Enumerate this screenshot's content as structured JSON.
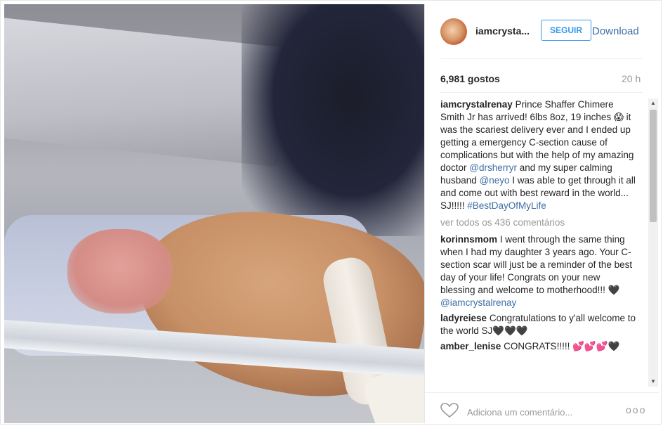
{
  "post": {
    "username": "iamcrysta...",
    "follow_label": "SEGUIR",
    "download_label": "Download",
    "likes": "6,981 gostos",
    "time": "20 h",
    "caption": {
      "user": "iamcrystalrenay",
      "text1": " Prince Shaffer Chimere Smith Jr has arrived! 6lbs 8oz, 19 inches 😱 it was the scariest delivery ever and I ended up getting a emergency C-section cause of complications but with the help of my amazing doctor ",
      "mention1": "@drsherryr",
      "text2": " and my super calming husband ",
      "mention2": "@neyo",
      "text3": " I was able to get through it all and come out with best reward in the world... SJ!!!!! ",
      "hashtag": "#BestDayOfMyLife"
    },
    "view_all": "ver todos os 436 comentários",
    "comments": [
      {
        "user": "korinnsmom",
        "text": " I went through the same thing when I had my daughter 3 years ago. Your C-section scar will just be a reminder of the best day of your life! Congrats on your new blessing and welcome to motherhood!!! 🖤 ",
        "mention": "@iamcrystalrenay"
      },
      {
        "user": "ladyreiese",
        "text": " Congratulations to y'all welcome to the world SJ🖤🖤🖤",
        "mention": ""
      },
      {
        "user": "amber_lenise",
        "text": " CONGRATS!!!!! 💕💕💕🖤",
        "mention": ""
      }
    ],
    "comment_placeholder": "Adiciona um comentário...",
    "more_label": "ooo"
  }
}
